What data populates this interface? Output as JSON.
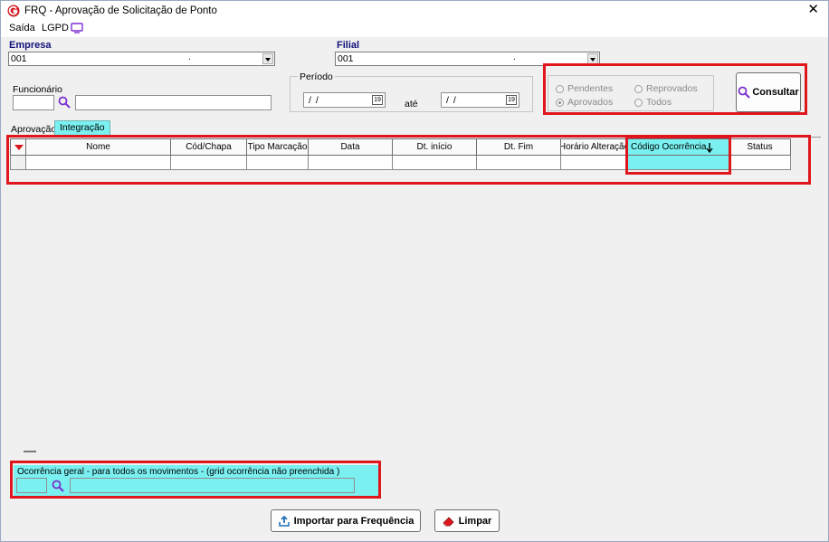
{
  "window": {
    "title": "FRQ - Aprovação de Solicitação de Ponto",
    "close_glyph": "✕"
  },
  "menu": {
    "items": [
      "Saída",
      "LGPD"
    ]
  },
  "empresa": {
    "label": "Empresa",
    "value": "001",
    "dot": "."
  },
  "filial": {
    "label": "Filial",
    "value": "001",
    "dot": "."
  },
  "funcionario": {
    "label": "Funcionário",
    "code": "",
    "name": ""
  },
  "periodo": {
    "label": "Período",
    "start": "/ /",
    "end": "/ /",
    "separator": "até",
    "calendar_glyph": "19"
  },
  "status_filter": {
    "options": [
      {
        "label": "Pendentes",
        "checked": false
      },
      {
        "label": "Reprovados",
        "checked": false
      },
      {
        "label": "Aprovados",
        "checked": true
      },
      {
        "label": "Todos",
        "checked": false
      }
    ]
  },
  "consultar": {
    "label": "Consultar"
  },
  "tabs": [
    {
      "label": "Aprovação",
      "active": false
    },
    {
      "label": "Integração",
      "active": true
    }
  ],
  "grid": {
    "columns": [
      "Nome",
      "Cód/Chapa",
      "Tipo Marcação",
      "Data",
      "Dt. início",
      "Dt. Fim",
      "Horário Alteração",
      "Código Ocorrência",
      "Status"
    ]
  },
  "ocorrencia_geral": {
    "label": "Ocorrência geral - para todos os movimentos - (grid ocorrência  não preenchida )",
    "code": "",
    "description": ""
  },
  "footer": {
    "import_label": "Importar para Frequência",
    "clear_label": "Limpar"
  },
  "colors": {
    "highlight": "#7af0f0",
    "annotation": "#e0161d",
    "label_blue": "#12127a",
    "icon_purple": "#7b2fd0"
  }
}
